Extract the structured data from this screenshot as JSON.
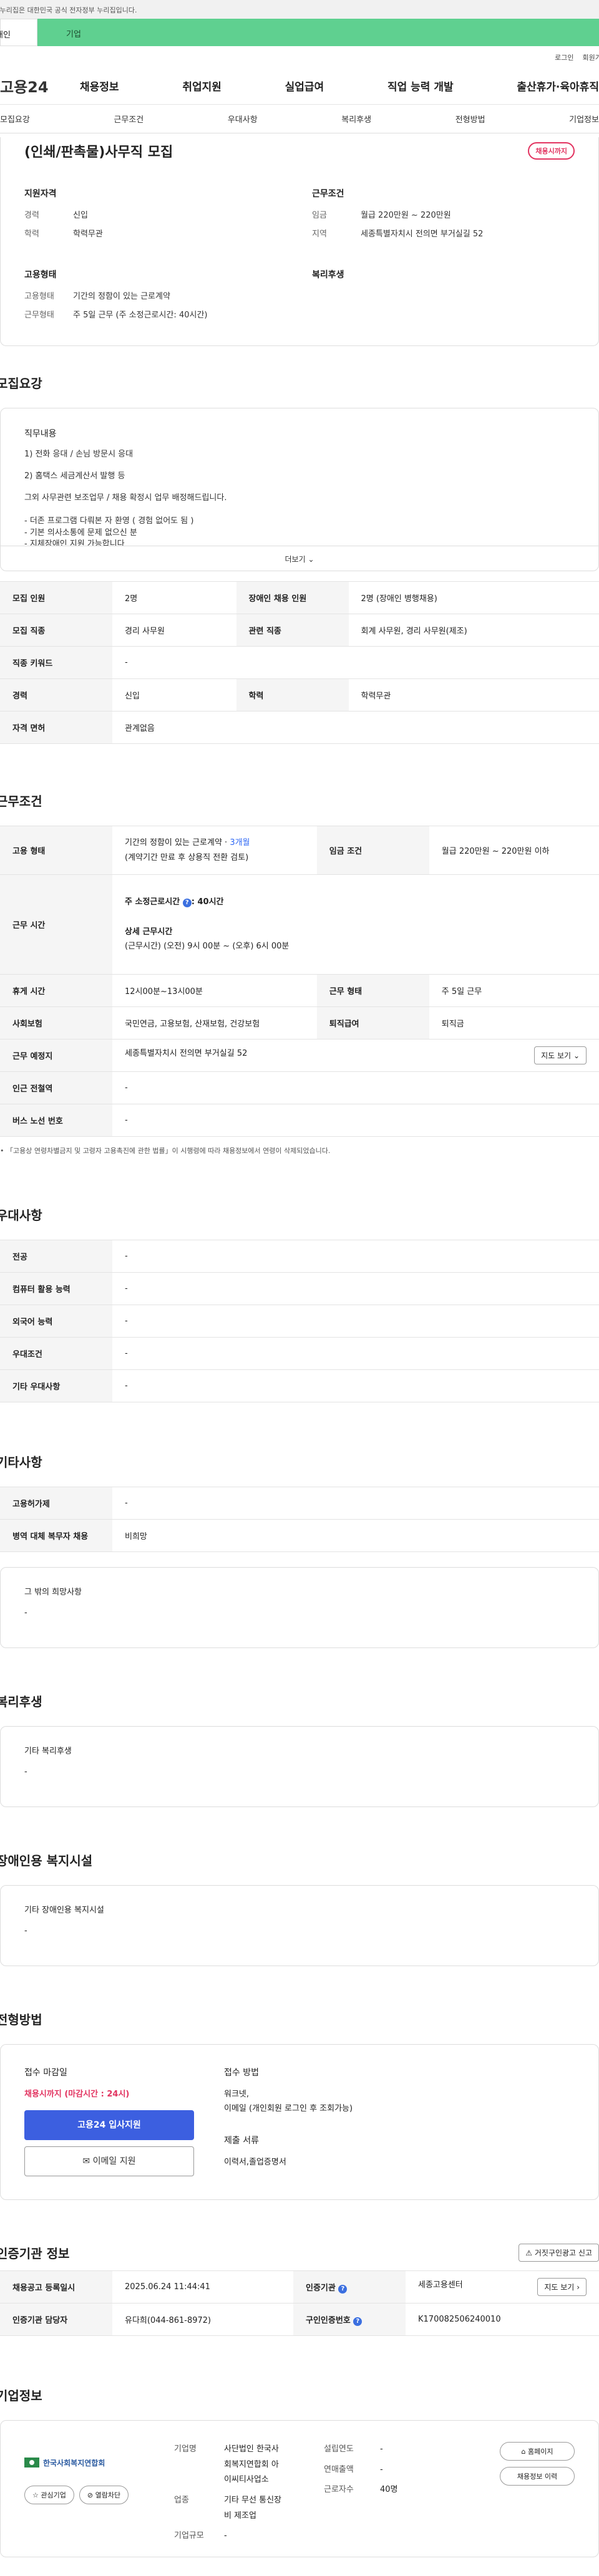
{
  "gov_notice": "이 누리집은 대한민국 공식 전자정부 누리집입니다.",
  "tabs": {
    "individual": "개인",
    "corporate": "기업"
  },
  "util": {
    "login": "로그인",
    "join": "회원가입"
  },
  "logo": "고용24",
  "gnb": [
    "채용정보",
    "취업지원",
    "실업급여",
    "직업 능력 개발",
    "출산휴가·육아휴직"
  ],
  "anchor_nav": [
    "모집요강",
    "근무조건",
    "우대사항",
    "복리후생",
    "전형방법",
    "기업정보"
  ],
  "summary": {
    "title": "(인쇄/판촉물)사무직 모집",
    "status": "채용시까지",
    "qual_title": "지원자격",
    "career_k": "경력",
    "career_v": "신입",
    "edu_k": "학력",
    "edu_v": "학력무관",
    "cond_title": "근무조건",
    "wage_k": "임금",
    "wage_v": "월급 220만원 ~ 220만원",
    "region_k": "지역",
    "region_v": "세종특별자치시 전의면 부거실길 52",
    "emp_title": "고용형태",
    "emptype_k": "고용형태",
    "emptype_v": "기간의 정함이 있는 근로계약",
    "worktype_k": "근무형태",
    "worktype_v": "주 5일 근무 (주 소정근로시간: 40시간)",
    "welfare_title": "복리후생"
  },
  "recruit": {
    "section_title": "모집요강",
    "duty_title": "직무내용",
    "duty_lines": [
      "1) 전화 응대 / 손님 방문시 응대",
      "2) 홈택스 세금계산서 발행 등",
      "그외 사무관련 보조업무 / 채용 확정시 업무 배정해드립니다.",
      "- 더존 프로그램 다뤄본 자 환영 ( 경험 없어도 됨 )",
      "- 기본 의사소통에 문제 없으신 분",
      "- 지체장애인 지원 가능합니다"
    ],
    "more": "더보기",
    "rows": [
      [
        "모집 인원",
        "2명",
        "장애인 채용 인원",
        "2명 (장애인 병행채용)"
      ],
      [
        "모집 직종",
        "경리 사무원",
        "관련 직종",
        "회계 사무원, 경리 사무원(제조)"
      ],
      [
        "직종 키워드",
        "-"
      ],
      [
        "경력",
        "신입",
        "학력",
        "학력무관"
      ],
      [
        "자격 면허",
        "관계없음"
      ]
    ]
  },
  "cond": {
    "section_title": "근무조건",
    "emptype_k": "고용 형태",
    "emptype_v1": "기간의 정함이 있는 근로계약 · ",
    "emptype_v1b": "3개월",
    "emptype_v2": "(계약기간 만료 후 상용직 전환 검토)",
    "wage_k": "임금 조건",
    "wage_v": "월급 220만원 ~ 220만원 이하",
    "worktime_k": "근무 시간",
    "worktime_week": "주 소정근로시간",
    "worktime_week_v": ": 40시간",
    "worktime_detail": "상세 근무시간",
    "worktime_detail_v": "(근무시간) (오전) 9시 00분 ~ (오후) 6시 00분",
    "break_k": "휴게 시간",
    "break_v": "12시00분~13시00분",
    "form_k": "근무 형태",
    "form_v": "주 5일 근무",
    "ins_k": "사회보험",
    "ins_v": "국민연금, 고용보험, 산재보험, 건강보험",
    "sev_k": "퇴직급여",
    "sev_v": "퇴직금",
    "place_k": "근무 예정지",
    "place_v": "세종특별자치시 전의면 부거실길 52",
    "map_btn": "지도 보기",
    "subway_k": "인근 전철역",
    "subway_v": "-",
    "bus_k": "버스 노선 번호",
    "bus_v": "-",
    "note": "「고용상 연령차별금지 및 고령자 고용촉진에 관한 법률」이 시행령에 따라 채용정보에서 연령이 삭제되었습니다."
  },
  "pref": {
    "section_title": "우대사항",
    "rows": [
      [
        "전공",
        "-"
      ],
      [
        "컴퓨터 활용 능력",
        "-"
      ],
      [
        "외국어 능력",
        "-"
      ],
      [
        "우대조건",
        "-"
      ],
      [
        "기타 우대사항",
        "-"
      ]
    ]
  },
  "etc": {
    "section_title": "기타사항",
    "rows": [
      [
        "고용허가제",
        "-"
      ],
      [
        "병역 대체 복무자 채용",
        "비희망"
      ]
    ],
    "other_title": "그 밖의 희망사항",
    "other_value": "-"
  },
  "welfare": {
    "section_title": "복리후생",
    "box_title": "기타 복리후생",
    "box_value": "-"
  },
  "disabled": {
    "section_title": "장애인용 복지시설",
    "box_title": "기타 장애인용 복지시설",
    "box_value": "-"
  },
  "process": {
    "section_title": "전형방법",
    "deadline_title": "접수 마감일",
    "deadline_value": "채용시까지 (마감시간 : 24시)",
    "apply_primary": "고용24 입사지원",
    "apply_email": "이메일 지원",
    "method_title": "접수 방법",
    "method_lines": [
      "워크넷,",
      "이메일 (개인회원 로그인 후 조회가능)"
    ],
    "docs_title": "제출 서류",
    "docs_value": "이력서,졸업증명서"
  },
  "agency": {
    "section_title": "인증기관 정보",
    "report_btn": "거짓구인광고 신고",
    "rows": [
      [
        "채용공고 등록일시",
        "2025.06.24 11:44:41",
        "인증기관",
        "세종고용센터"
      ],
      [
        "인증기관 담당자",
        "유다희(044-861-8972)",
        "구인인증번호",
        "K170082506240010"
      ]
    ],
    "map_btn": "지도 보기"
  },
  "company": {
    "section_title": "기업정보",
    "logo_text": "한국사회복지연합회",
    "interest_btn": "관심기업",
    "block_btn": "열람차단",
    "name_k": "기업명",
    "name_v": [
      "사단법인 한국사",
      "회복지연합회 아",
      "이씨티사업소"
    ],
    "year_k": "설립연도",
    "year_v": "-",
    "sales_k": "연매출액",
    "sales_v": "-",
    "emp_k": "근로자수",
    "emp_v": "40명",
    "ind_k": "업종",
    "ind_v": [
      "기타 무선 통신장",
      "비 제조업"
    ],
    "size_k": "기업규모",
    "size_v": "-",
    "homepage_btn": "홈페이지",
    "history_btn": "채용정보 이력"
  }
}
